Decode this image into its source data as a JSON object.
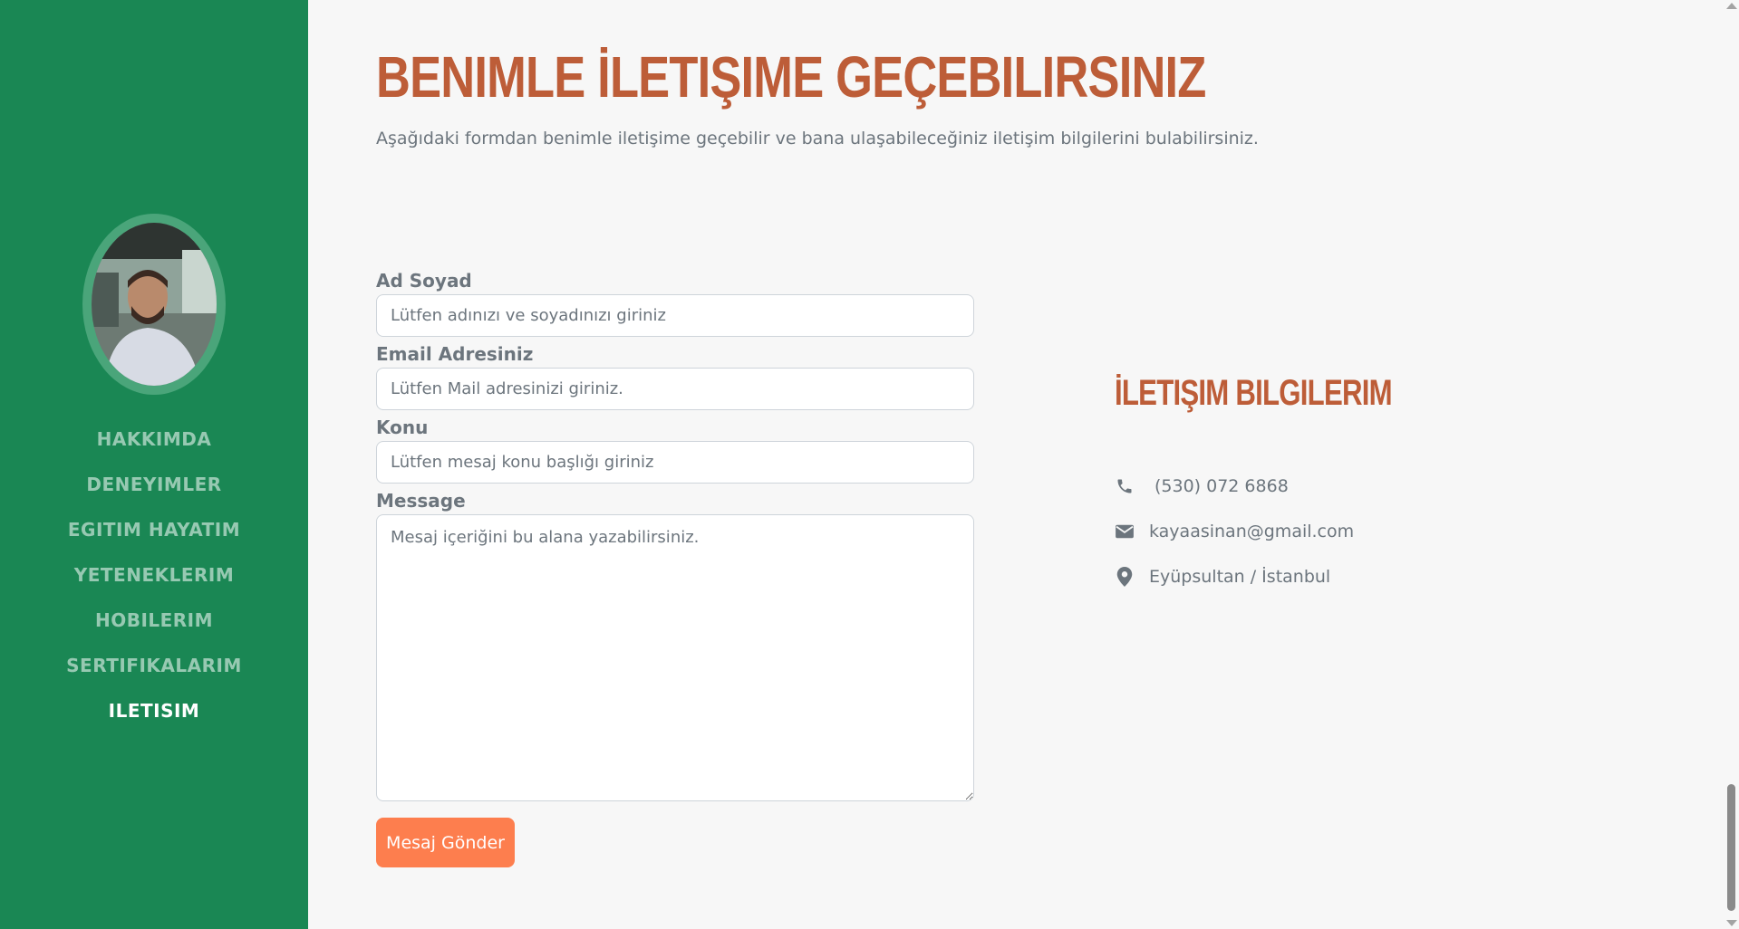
{
  "sidebar": {
    "avatar_alt": "Profile photo",
    "nav": [
      {
        "label": "HAKKIMDA",
        "active": false
      },
      {
        "label": "DENEYIMLER",
        "active": false
      },
      {
        "label": "EGITIM HAYATIM",
        "active": false
      },
      {
        "label": "YETENEKLERIM",
        "active": false
      },
      {
        "label": "HOBILERIM",
        "active": false
      },
      {
        "label": "SERTIFIKALARIM",
        "active": false
      },
      {
        "label": "ILETISIM",
        "active": true
      }
    ]
  },
  "main": {
    "title": "BENIMLE İLETIŞIME GEÇEBILIRSINIZ",
    "subtitle": "Aşağıdaki formdan benimle iletişime geçebilir ve bana ulaşabileceğiniz iletişim bilgilerini bulabilirsiniz."
  },
  "form": {
    "name": {
      "label": "Ad Soyad",
      "placeholder": "Lütfen adınızı ve soyadınızı giriniz",
      "value": ""
    },
    "email": {
      "label": "Email Adresiniz",
      "placeholder": "Lütfen Mail adresinizi giriniz.",
      "value": ""
    },
    "subject": {
      "label": "Konu",
      "placeholder": "Lütfen mesaj konu başlığı giriniz",
      "value": ""
    },
    "message": {
      "label": "Message",
      "placeholder": "Mesaj içeriğini bu alana yazabilirsiniz.",
      "value": ""
    },
    "submit_label": "Mesaj Gönder"
  },
  "contact": {
    "title": "İLETIŞIM BILGILERIM",
    "phone": "(530) 072 6868",
    "email": "kayaasinan@gmail.com",
    "location": "Eyüpsultan / İstanbul"
  },
  "colors": {
    "sidebar": "#1a8754",
    "accent": "#bd5d38",
    "button": "#fd7e4e",
    "muted_text": "#6c757d"
  },
  "icons": {
    "phone": "phone-icon",
    "email": "envelope-icon",
    "location": "map-marker-icon"
  }
}
